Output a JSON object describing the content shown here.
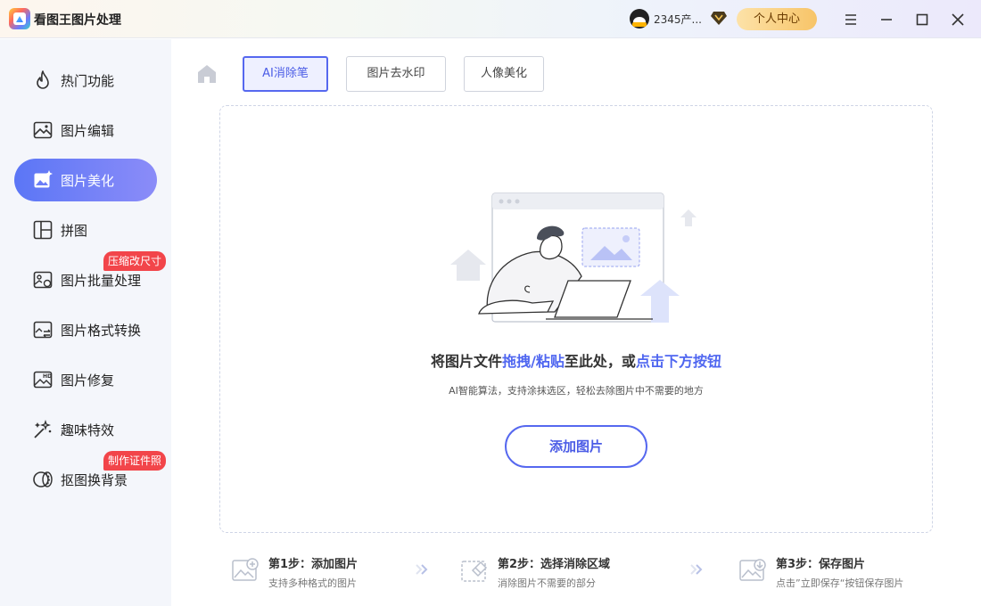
{
  "app": {
    "title": "看图王图片处理"
  },
  "titlebar": {
    "user_name": "2345产...",
    "user_center": "个人中心",
    "icons": [
      "qq-avatar-icon",
      "vip-diamond-icon",
      "menu-icon",
      "minimize-icon",
      "maximize-icon",
      "close-icon"
    ]
  },
  "sidebar": {
    "items": [
      {
        "label": "热门功能",
        "icon": "fire-icon"
      },
      {
        "label": "图片编辑",
        "icon": "image-edit-icon"
      },
      {
        "label": "图片美化",
        "icon": "image-beautify-icon",
        "active": true
      },
      {
        "label": "拼图",
        "icon": "collage-icon"
      },
      {
        "label": "图片批量处理",
        "icon": "batch-image-icon",
        "badge": "压缩改尺寸"
      },
      {
        "label": "图片格式转换",
        "icon": "format-convert-icon"
      },
      {
        "label": "图片修复",
        "icon": "hd-repair-icon"
      },
      {
        "label": "趣味特效",
        "icon": "magic-wand-icon"
      },
      {
        "label": "抠图换背景",
        "icon": "cutout-icon",
        "badge": "制作证件照"
      }
    ]
  },
  "tabs": [
    {
      "label": "AI消除笔",
      "active": true
    },
    {
      "label": "图片去水印"
    },
    {
      "label": "人像美化"
    }
  ],
  "dropzone": {
    "title_part1": "将图片文件",
    "title_hl1": "拖拽/粘贴",
    "title_part2": "至此处，或",
    "title_hl2": "点击下方按钮",
    "subtitle": "AI智能算法，支持涂抹选区，轻松去除图片中不需要的地方",
    "button": "添加图片"
  },
  "steps": [
    {
      "title": "第1步：添加图片",
      "desc": "支持多种格式的图片",
      "icon": "add-image-icon"
    },
    {
      "title": "第2步：选择消除区域",
      "desc": "消除图片不需要的部分",
      "icon": "eraser-icon"
    },
    {
      "title": "第3步：保存图片",
      "desc": "点击”立即保存“按钮保存图片",
      "icon": "save-image-icon"
    }
  ],
  "colors": {
    "accent": "#5668ef",
    "badge": "#f2454a",
    "gold": "#f7c468"
  }
}
